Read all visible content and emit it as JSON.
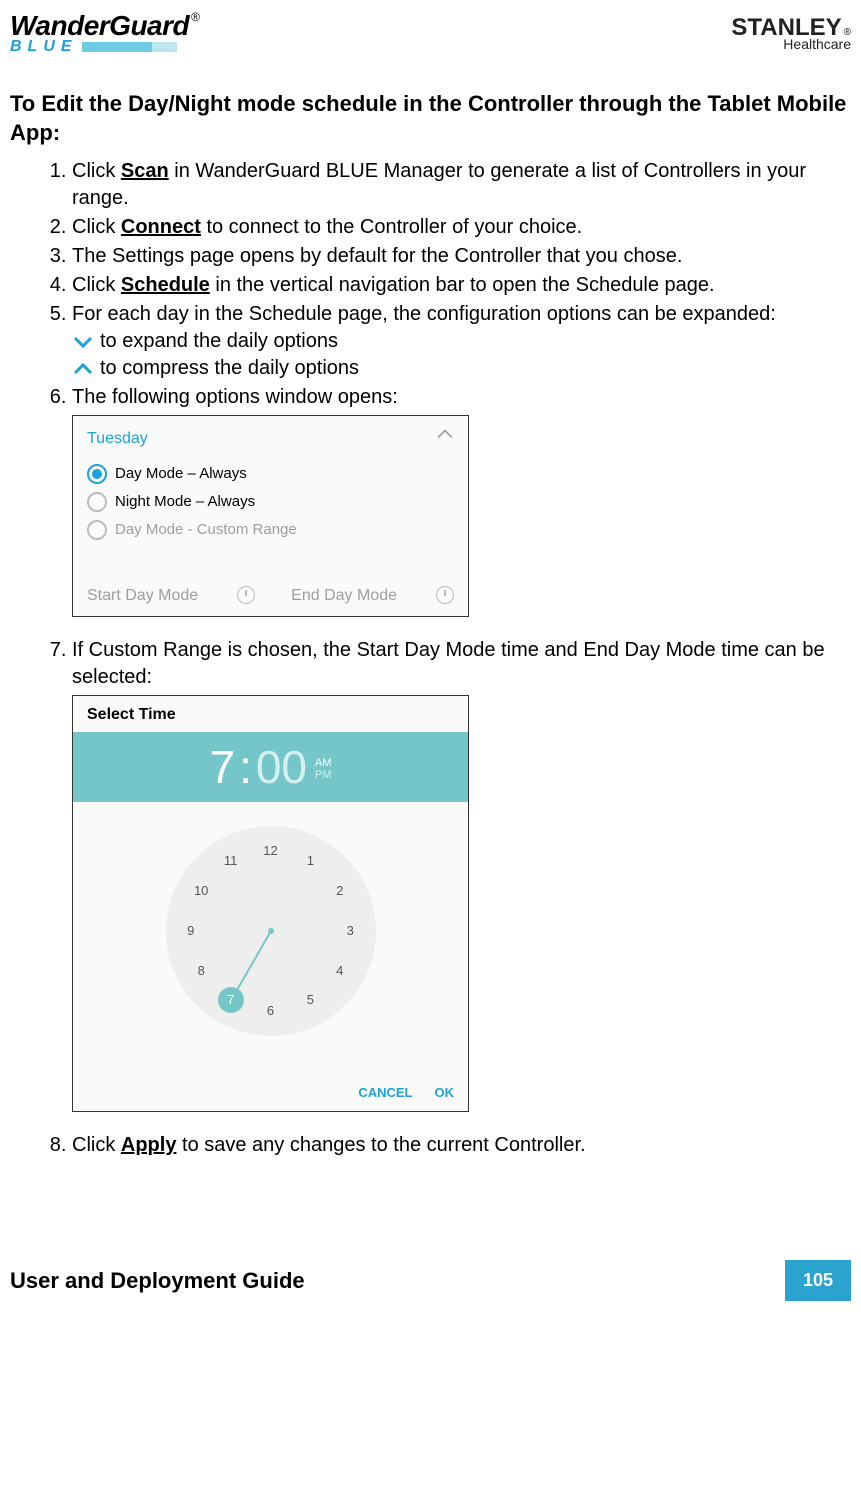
{
  "header": {
    "wg_word": "WanderGuard",
    "wg_reg": "®",
    "wg_blue": "BLUE",
    "st_word": "STANLEY",
    "st_reg": "®",
    "st_hc": "Healthcare"
  },
  "section_title": "To Edit the Day/Night mode schedule in the Controller through the Tablet Mobile App:",
  "steps": {
    "s1a": "Click ",
    "s1b": "Scan",
    "s1c": " in WanderGuard BLUE Manager to generate a list of Controllers in your range.",
    "s2a": "Click ",
    "s2b": "Connect",
    "s2c": " to connect to the Controller of your choice.",
    "s3": "The Settings page opens by default for the Controller that you chose.",
    "s4a": "Click ",
    "s4b": "Schedule",
    "s4c": " in the vertical navigation bar to open the Schedule page.",
    "s5": "For each day in the Schedule page, the configuration options can be expanded:",
    "s5_exp": " to expand the daily options",
    "s5_col": "to compress the daily options",
    "s6": "The following options window opens:",
    "s7": "If Custom Range is chosen, the Start Day Mode time and End Day Mode time can be selected:",
    "s8a": "Click ",
    "s8b": "Apply",
    "s8c": " to save any changes to the current Controller."
  },
  "shot1": {
    "day": "Tuesday",
    "opt1": "Day Mode – Always",
    "opt2": "Night Mode – Always",
    "opt3": "Day Mode - Custom Range",
    "start": "Start Day Mode",
    "end": "End Day Mode"
  },
  "shot2": {
    "title": "Select Time",
    "hour": "7",
    "sep": ":",
    "min": "00",
    "am": "AM",
    "pm": "PM",
    "numbers": {
      "n1": "1",
      "n2": "2",
      "n3": "3",
      "n4": "4",
      "n5": "5",
      "n6": "6",
      "n7": "7",
      "n8": "8",
      "n9": "9",
      "n10": "10",
      "n11": "11",
      "n12": "12"
    },
    "cancel": "CANCEL",
    "ok": "OK"
  },
  "footer": {
    "title": "User and Deployment Guide",
    "page": "105"
  }
}
